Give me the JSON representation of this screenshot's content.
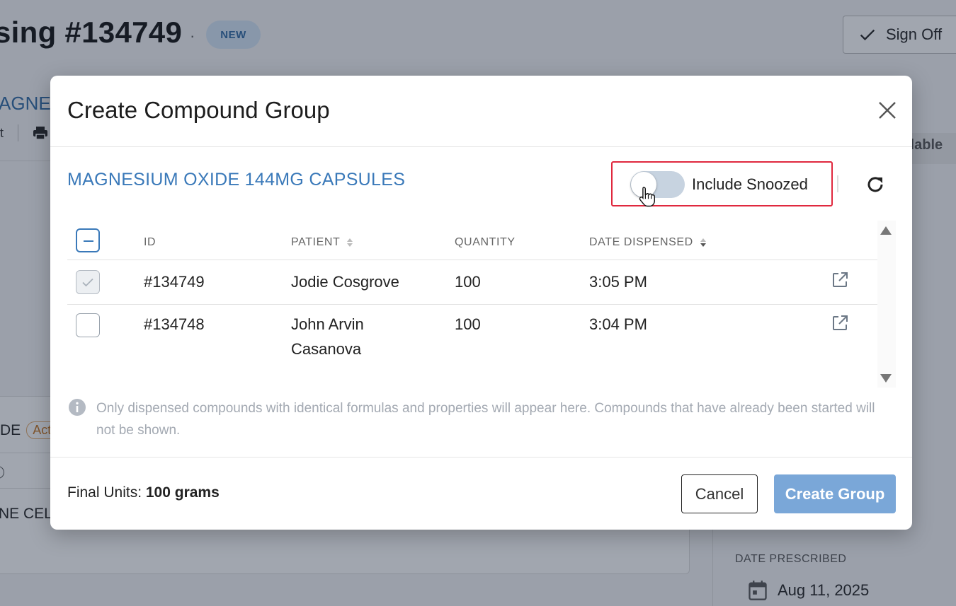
{
  "background": {
    "title": "sing #134749",
    "title_dot": "·",
    "status_badge": "NEW",
    "signoff_label": "Sign Off",
    "drug_partial": "AGNE",
    "toolbar_text": "t",
    "available_partial": "ilable",
    "row_partial": "DE",
    "active_badge": "Acti",
    "name_partial": "NE CEL",
    "date_prescribed_label": "DATE PRESCRIBED",
    "date_prescribed_value": "Aug 11, 2025"
  },
  "modal": {
    "title": "Create Compound Group",
    "drug_name": "MAGNESIUM OXIDE 144MG CAPSULES",
    "include_snoozed_label": "Include Snoozed",
    "include_snoozed_on": false,
    "table": {
      "columns": [
        "ID",
        "PATIENT",
        "QUANTITY",
        "DATE DISPENSED"
      ],
      "rows": [
        {
          "id": "#134749",
          "patient": "Jodie Cosgrove",
          "quantity": "100",
          "date_dispensed": "3:05 PM",
          "checked": true,
          "disabled": true
        },
        {
          "id": "#134748",
          "patient": "John Arvin",
          "patient_line2": "Casanova",
          "quantity": "100",
          "date_dispensed": "3:04 PM",
          "checked": false,
          "disabled": false
        }
      ]
    },
    "info_text": "Only dispensed compounds with identical formulas and properties will appear here. Compounds that have already been started will not be shown.",
    "final_units_label": "Final Units:",
    "final_units_value": "100 grams",
    "cancel_label": "Cancel",
    "create_label": "Create Group"
  },
  "colors": {
    "accent": "#3a79b9",
    "primary_button": "#7aa7d8",
    "highlight_border": "#e0283e",
    "overlay": "rgba(32,42,64,0.42)"
  },
  "icons": {
    "close": "close-icon",
    "refresh": "refresh-icon",
    "external": "external-link-icon",
    "info": "info-icon",
    "sort": "sort-icon",
    "check": "check-icon",
    "calendar": "calendar-icon",
    "printer": "printer-icon",
    "cursor": "hand-cursor-icon"
  }
}
